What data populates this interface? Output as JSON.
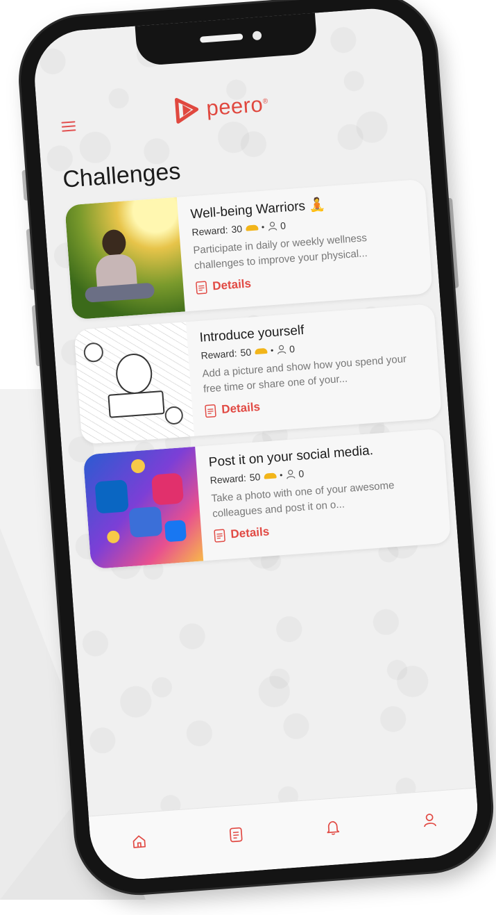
{
  "app": {
    "brand": "peero",
    "brand_mark": "®",
    "accent": "#e0483f"
  },
  "page": {
    "title": "Challenges"
  },
  "challenges": [
    {
      "title": "Well-being Warriors 🧘",
      "reward_label": "Reward:",
      "reward_points": "30",
      "participants": "0",
      "description": "Participate in daily or weekly wellness challenges to improve your physical...",
      "details_label": "Details"
    },
    {
      "title": "Introduce yourself",
      "reward_label": "Reward:",
      "reward_points": "50",
      "participants": "0",
      "description": "Add a picture and show how you spend your free time or share one of your...",
      "details_label": "Details"
    },
    {
      "title": "Post it on your social media.",
      "reward_label": "Reward:",
      "reward_points": "50",
      "participants": "0",
      "description": "Take a photo with one of your awesome colleagues and post it on o...",
      "details_label": "Details"
    }
  ],
  "tabbar": {
    "items": [
      {
        "icon": "home-icon"
      },
      {
        "icon": "challenges-icon"
      },
      {
        "icon": "bell-icon"
      },
      {
        "icon": "profile-icon"
      }
    ]
  }
}
